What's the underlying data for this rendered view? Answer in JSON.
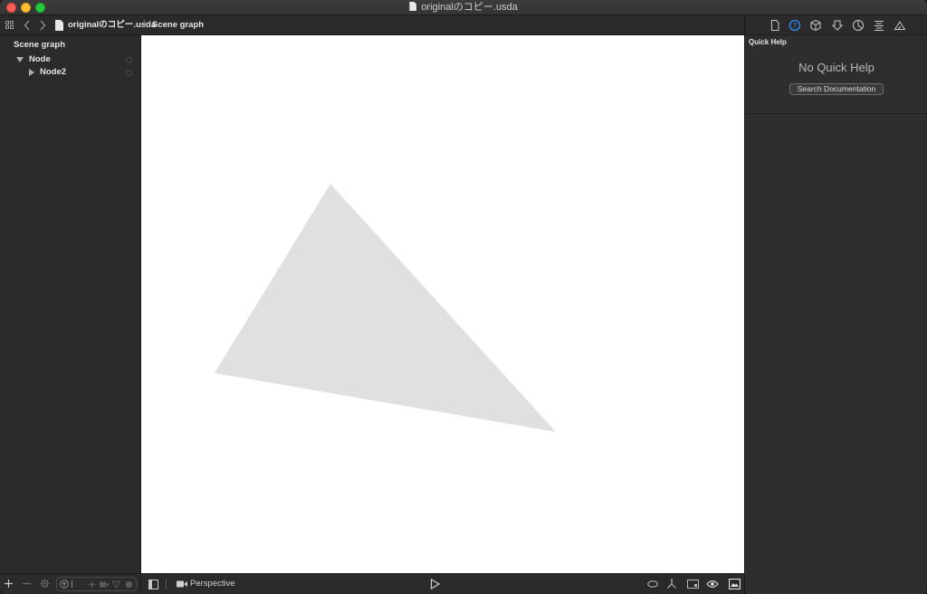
{
  "window": {
    "title": "originalのコピー.usda"
  },
  "pathbar": {
    "file": "originalのコピー.usda",
    "separator": "〉",
    "section": "Scene graph"
  },
  "sidebar": {
    "header": "Scene graph",
    "tree": [
      {
        "label": "Node",
        "expanded": true
      },
      {
        "label": "Node2",
        "expanded": false
      }
    ]
  },
  "inspector": {
    "title": "Quick Help",
    "empty_text": "No Quick Help",
    "search_button": "Search Documentation",
    "tabs": [
      "file-icon",
      "quick-help-icon",
      "cube-icon",
      "node-icon",
      "material-icon",
      "attributes-icon",
      "physics-icon"
    ],
    "active_tab": "quick-help-icon"
  },
  "viewport": {
    "background": "#ffffff",
    "shape_color": "#e0e0e0",
    "camera_label": "Perspective"
  },
  "colors": {
    "accent": "#2f8cff",
    "close": "#ff5f57",
    "minimize": "#febc2e",
    "maximize": "#28c840"
  }
}
